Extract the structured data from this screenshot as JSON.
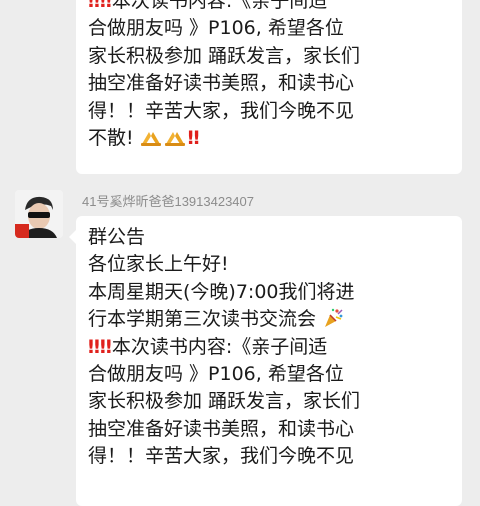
{
  "messages": [
    {
      "lines": [
        "本次读书内容:《亲子间适",
        "合做朋友吗 》P106,   希望各位",
        "家长积极参加 踊跃发言，家长们",
        "抽空准备好读书美照，和读书心",
        "得！！辛苦大家，我们今晚不见",
        "不散!"
      ]
    },
    {
      "sender": "41号奚烨昕爸爸13913423407",
      "lines": [
        "群公告",
        "各位家长上午好!",
        "本周星期天(今晚)7:00我们将进",
        "行本学期第三次读书交流会",
        "本次读书内容:《亲子间适",
        "合做朋友吗 》P106,   希望各位",
        "家长积极参加 踊跃发言，家长们",
        "抽空准备好读书美照，和读书心",
        "得！！辛苦大家，我们今晚不见"
      ]
    }
  ],
  "icons": {
    "double_exclamation": "‼",
    "praying_hands": "praying-hands-icon",
    "party_popper": "party-popper-icon"
  }
}
